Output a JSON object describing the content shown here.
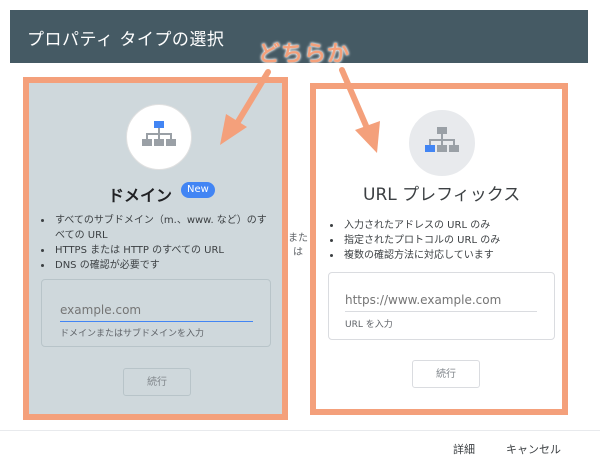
{
  "header": {
    "title": "プロパティ タイプの選択"
  },
  "annotation": {
    "text": "どちらか"
  },
  "domain_card": {
    "title": "ドメイン",
    "badge": "New",
    "bullets": [
      "すべてのサブドメイン（m.、www. など）のすべての URL",
      "HTTPS または HTTP のすべての URL",
      "DNS の確認が必要です"
    ],
    "input": {
      "placeholder": "example.com",
      "helper": "ドメインまたはサブドメインを入力"
    },
    "continue_label": "続行"
  },
  "url_card": {
    "title": "URL プレフィックス",
    "bullets": [
      "入力されたアドレスの URL のみ",
      "指定されたプロトコルの URL のみ",
      "複数の確認方法に対応しています"
    ],
    "input": {
      "placeholder": "https://www.example.com",
      "helper": "URL を入力"
    },
    "continue_label": "続行"
  },
  "separator": {
    "text": "または"
  },
  "footer": {
    "details_label": "詳細",
    "cancel_label": "キャンセル"
  },
  "colors": {
    "header_bg": "#455a64",
    "annotation": "#f4a07b",
    "accent": "#4285f4",
    "domain_bg": "#cfd8dc"
  }
}
